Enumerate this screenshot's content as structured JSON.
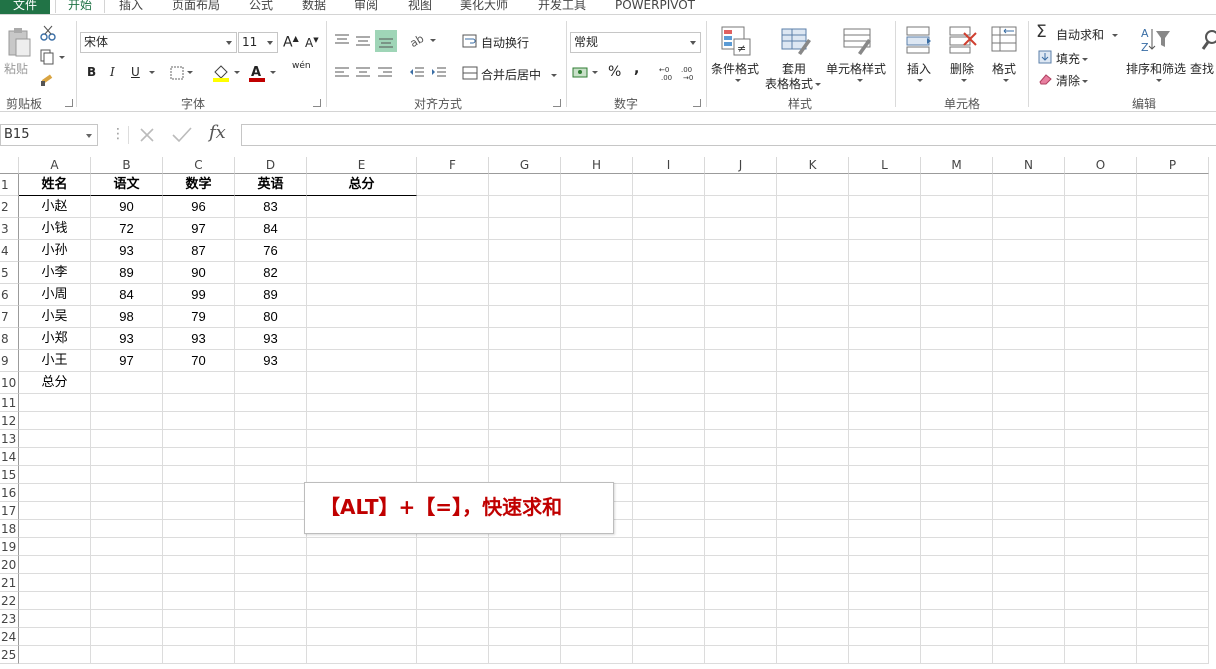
{
  "tabs": [
    "文件",
    "开始",
    "插入",
    "页面布局",
    "公式",
    "数据",
    "审阅",
    "视图",
    "美化大师",
    "开发工具",
    "POWERPIVOT"
  ],
  "active_tab": "开始",
  "accent_color": "#217346",
  "clipboard": {
    "paste_label": "粘贴",
    "group_label": "剪贴板"
  },
  "font": {
    "name": "宋体",
    "size": "11",
    "group_label": "字体",
    "bold": "B",
    "italic": "I",
    "underline": "U",
    "phonetic": "wén"
  },
  "alignment": {
    "wrap_label": "自动换行",
    "merge_label": "合并后居中",
    "group_label": "对齐方式"
  },
  "number": {
    "format": "常规",
    "percent": "%",
    "comma": ",",
    "group_label": "数字"
  },
  "styles": {
    "conditional_label": "条件格式",
    "table_label_1": "套用",
    "table_label_2": "表格格式",
    "cell_style_label": "单元格样式",
    "group_label": "样式"
  },
  "cells_group": {
    "insert_label": "插入",
    "delete_label": "删除",
    "format_label": "格式",
    "group_label": "单元格"
  },
  "editing": {
    "autosum_label": "自动求和",
    "fill_label": "填充",
    "clear_label": "清除",
    "sort_label": "排序和筛选",
    "find_label": "查找",
    "group_label": "编辑"
  },
  "formula_bar": {
    "name_box": "B15",
    "fx": "fx",
    "value": ""
  },
  "columns": [
    "A",
    "B",
    "C",
    "D",
    "E",
    "F",
    "G",
    "H",
    "I",
    "J",
    "K",
    "L",
    "M",
    "N",
    "O",
    "P"
  ],
  "rows": [
    "1",
    "2",
    "3",
    "4",
    "5",
    "6",
    "7",
    "8",
    "9",
    "10",
    "11",
    "12",
    "13",
    "14",
    "15",
    "16",
    "17",
    "18",
    "19",
    "20",
    "21",
    "22",
    "23",
    "24",
    "25"
  ],
  "table": {
    "headers": [
      "姓名",
      "语文",
      "数学",
      "英语",
      "总分"
    ],
    "rows": [
      [
        "小赵",
        "90",
        "96",
        "83"
      ],
      [
        "小钱",
        "72",
        "97",
        "84"
      ],
      [
        "小孙",
        "93",
        "87",
        "76"
      ],
      [
        "小李",
        "89",
        "90",
        "82"
      ],
      [
        "小周",
        "84",
        "99",
        "89"
      ],
      [
        "小吴",
        "98",
        "79",
        "80"
      ],
      [
        "小郑",
        "93",
        "93",
        "93"
      ],
      [
        "小王",
        "97",
        "70",
        "93"
      ]
    ],
    "total_label": "总分"
  },
  "callout_text": "【ALT】+【=】，快速求和"
}
